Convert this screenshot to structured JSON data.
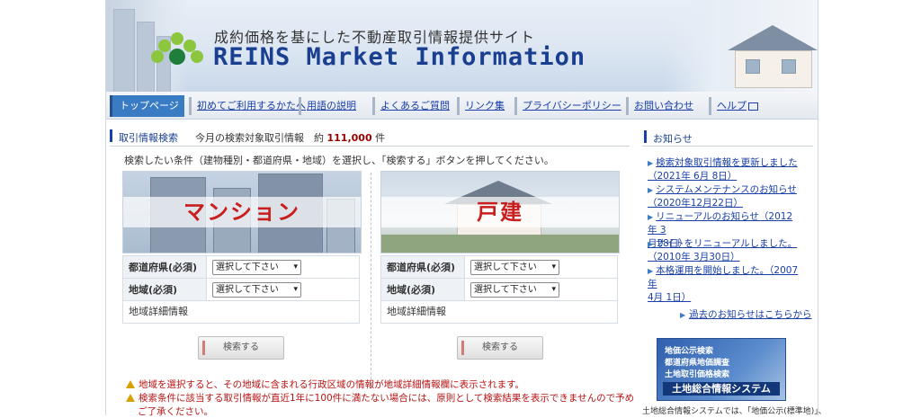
{
  "header": {
    "tagline": "成約価格を基にした不動産取引情報提供サイト",
    "brand": "REINS Market Information"
  },
  "nav": {
    "items": [
      {
        "label": "トップページ",
        "active": true
      },
      {
        "label": "初めてご利用するかたへ"
      },
      {
        "label": "用語の説明"
      },
      {
        "label": "よくあるご質問"
      },
      {
        "label": "リンク集"
      },
      {
        "label": "プライバシーポリシー"
      },
      {
        "label": "お問い合わせ"
      },
      {
        "label": "ヘルプ"
      }
    ]
  },
  "main": {
    "title": "取引情報検索",
    "count_prefix": "今月の検索対象取引情報　約",
    "count_value": "111,000",
    "count_suffix": "件",
    "instruction": "検索したい条件（建物種別・都道府県・地域）を選択し、「検索する」ボタンを押してください。",
    "columns": [
      {
        "heading": "マンション",
        "prefecture_label": "都道府県(必須)",
        "prefecture_value": "選択して下さい",
        "area_label": "地域(必須)",
        "area_value": "選択して下さい",
        "detail_label": "地域詳細情報",
        "search_button": "検索する"
      },
      {
        "heading": "戸建",
        "prefecture_label": "都道府県(必須)",
        "prefecture_value": "選択して下さい",
        "area_label": "地域(必須)",
        "area_value": "選択して下さい",
        "detail_label": "地域詳細情報",
        "search_button": "検索する"
      }
    ],
    "notes": [
      "地域を選択すると、その地域に含まれる行政区域の情報が地域詳細情報欄に表示されます。",
      "検索条件に該当する取引情報が直近1年に100件に満たない場合には、原則として検索結果を表示できませんので予め",
      "ご了承ください。"
    ]
  },
  "sidebar": {
    "title": "お知らせ",
    "news": [
      {
        "line1": "検索対象取引情報を更新しました",
        "line2": "（2021年 6月 8日）"
      },
      {
        "line1": "システムメンテナンスのお知らせ",
        "line2": "（2020年12月22日）"
      },
      {
        "line1": "リニューアルのお知らせ（2012年 3",
        "line2": "月28日）"
      },
      {
        "line1": "サイトをリニューアルしました。",
        "line2": "（2010年 3月30日）"
      },
      {
        "line1": "本格運用を開始しました。（2007年",
        "line2": "4月 1日）"
      }
    ],
    "past_link": "過去のお知らせはこちらから",
    "banner": {
      "line1": "地価公示検索",
      "line2": "都道府県地価調査",
      "line3": "土地取引価格検索",
      "big": "土地総合情報システム"
    },
    "footer_text": "土地総合情報システムでは、「地価公示(標準地)」、"
  },
  "colors": {
    "brand": "#1a3f91",
    "nav_active": "#3a7cc4",
    "link": "#1a40a8",
    "count": "#990000",
    "warning": "#b81414",
    "label_red": "#c81e1e"
  }
}
